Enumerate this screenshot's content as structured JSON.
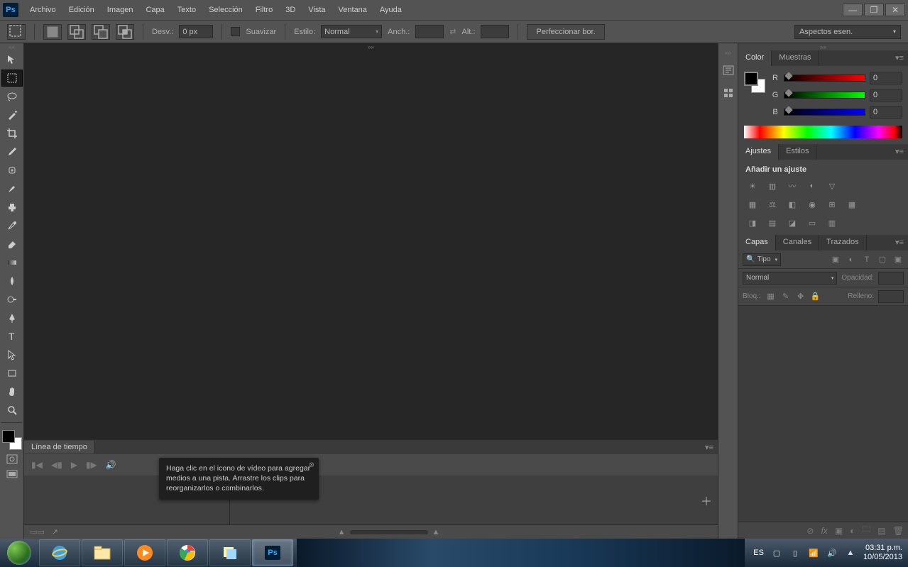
{
  "app": {
    "logo": "Ps"
  },
  "menubar": [
    "Archivo",
    "Edición",
    "Imagen",
    "Capa",
    "Texto",
    "Selección",
    "Filtro",
    "3D",
    "Vista",
    "Ventana",
    "Ayuda"
  ],
  "optionsbar": {
    "desv_label": "Desv.:",
    "desv_value": "0 px",
    "suavizar": "Suavizar",
    "estilo_label": "Estilo:",
    "estilo_value": "Normal",
    "anch_label": "Anch.:",
    "alt_label": "Alt.:",
    "perfeccionar": "Perfeccionar bor.",
    "workspace": "Aspectos esen."
  },
  "timeline": {
    "tab": "Línea de tiempo",
    "tooltip": "Haga clic en el icono de vídeo para agregar medios a una pista. Arrastre los clips para reorganizarlos o combinarlos."
  },
  "color_panel": {
    "tab_color": "Color",
    "tab_muestras": "Muestras",
    "r_label": "R",
    "r_value": "0",
    "g_label": "G",
    "g_value": "0",
    "b_label": "B",
    "b_value": "0"
  },
  "adjust_panel": {
    "tab_ajustes": "Ajustes",
    "tab_estilos": "Estilos",
    "heading": "Añadir un ajuste"
  },
  "layers_panel": {
    "tab_capas": "Capas",
    "tab_canales": "Canales",
    "tab_trazados": "Trazados",
    "filter_kind": "Tipo",
    "blend_mode": "Normal",
    "opacity_label": "Opacidad:",
    "lock_label": "Bloq.:",
    "fill_label": "Relleno:"
  },
  "taskbar": {
    "lang": "ES",
    "time": "03:31 p.m.",
    "date": "10/05/2013"
  }
}
